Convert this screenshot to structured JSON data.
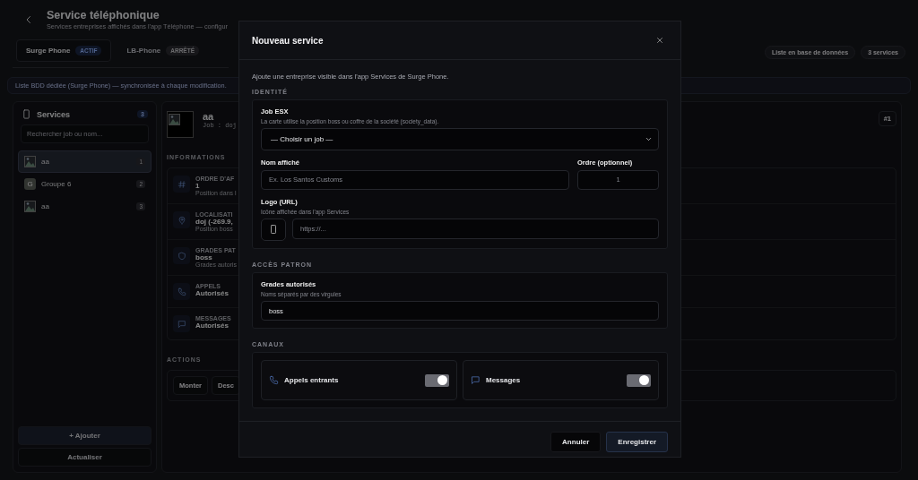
{
  "header": {
    "title": "Service téléphonique",
    "subtitle": "Services entreprises affichés dans l'app Téléphone — configur"
  },
  "tabs": [
    {
      "label": "Surge Phone",
      "badge": "ACTIF",
      "kind": "active",
      "selected": true
    },
    {
      "label": "LB-Phone",
      "badge": "ARRÊTÉ",
      "kind": "stopped",
      "selected": false
    }
  ],
  "header_badges": [
    "Liste en base de données",
    "3 services"
  ],
  "info_bar": "Liste BDD dédiée (Surge Phone) — synchronisée à chaque modification.",
  "sidebar": {
    "title": "Services",
    "count": "3",
    "search": {
      "placeholder": "Rechercher job ou nom..."
    },
    "items": [
      {
        "name": "aa",
        "order": "1",
        "kind": "image",
        "selected": true
      },
      {
        "name": "Groupe 6",
        "order": "2",
        "kind": "letter",
        "letter": "G",
        "selected": false
      },
      {
        "name": "aa",
        "order": "3",
        "kind": "image",
        "selected": false
      }
    ],
    "buttons": [
      {
        "label": "+ Ajouter",
        "kind": "primary"
      },
      {
        "label": "Actualiser",
        "kind": "secondary"
      }
    ]
  },
  "detail": {
    "name": "aa",
    "job": "Job : doj",
    "order_badge": "#1",
    "info_title": "INFORMATIONS",
    "rows": [
      {
        "kind": "hash",
        "label": "ORDRE D'AF",
        "value": "1",
        "hint": "Position dans l"
      },
      {
        "kind": "pin",
        "label": "LOCALISATI",
        "value": "doj (-269.9,",
        "hint": "Position boss"
      },
      {
        "kind": "shield",
        "label": "GRADES PAT",
        "value": "boss",
        "hint": "Grades autoris"
      },
      {
        "kind": "phone",
        "label": "APPELS",
        "value": "Autorisés"
      },
      {
        "kind": "message",
        "label": "MESSAGES",
        "value": "Autorisés"
      }
    ],
    "actions_title": "ACTIONS",
    "actions": [
      "Monter",
      "Desc"
    ]
  },
  "modal": {
    "title": "Nouveau service",
    "description": "Ajoute une entreprise visible dans l'app Services de Surge Phone.",
    "identity": {
      "title": "IDENTITÉ",
      "job": {
        "label": "Job ESX",
        "hint": "La carte utilise la position boss ou coffre de la société (society_data).",
        "value": "— Choisir un job —"
      },
      "name": {
        "label": "Nom affiché",
        "placeholder": "Ex. Los Santos Customs"
      },
      "order": {
        "label": "Ordre (optionnel)",
        "placeholder": "1"
      },
      "logo": {
        "label": "Logo (URL)",
        "hint": "Icône affichée dans l'app Services",
        "placeholder": "https://..."
      }
    },
    "boss_access": {
      "title": "ACCÈS PATRON",
      "grades": {
        "label": "Grades autorisés",
        "hint": "Noms séparés par des virgules",
        "value": "boss"
      }
    },
    "channels": {
      "title": "CANAUX",
      "items": [
        {
          "kind": "calls",
          "label": "Appels entrants",
          "on": true
        },
        {
          "kind": "messages",
          "label": "Messages",
          "on": true
        }
      ]
    },
    "buttons": [
      {
        "label": "Annuler",
        "kind": "secondary"
      },
      {
        "label": "Enregistrer",
        "kind": "primary"
      }
    ]
  }
}
